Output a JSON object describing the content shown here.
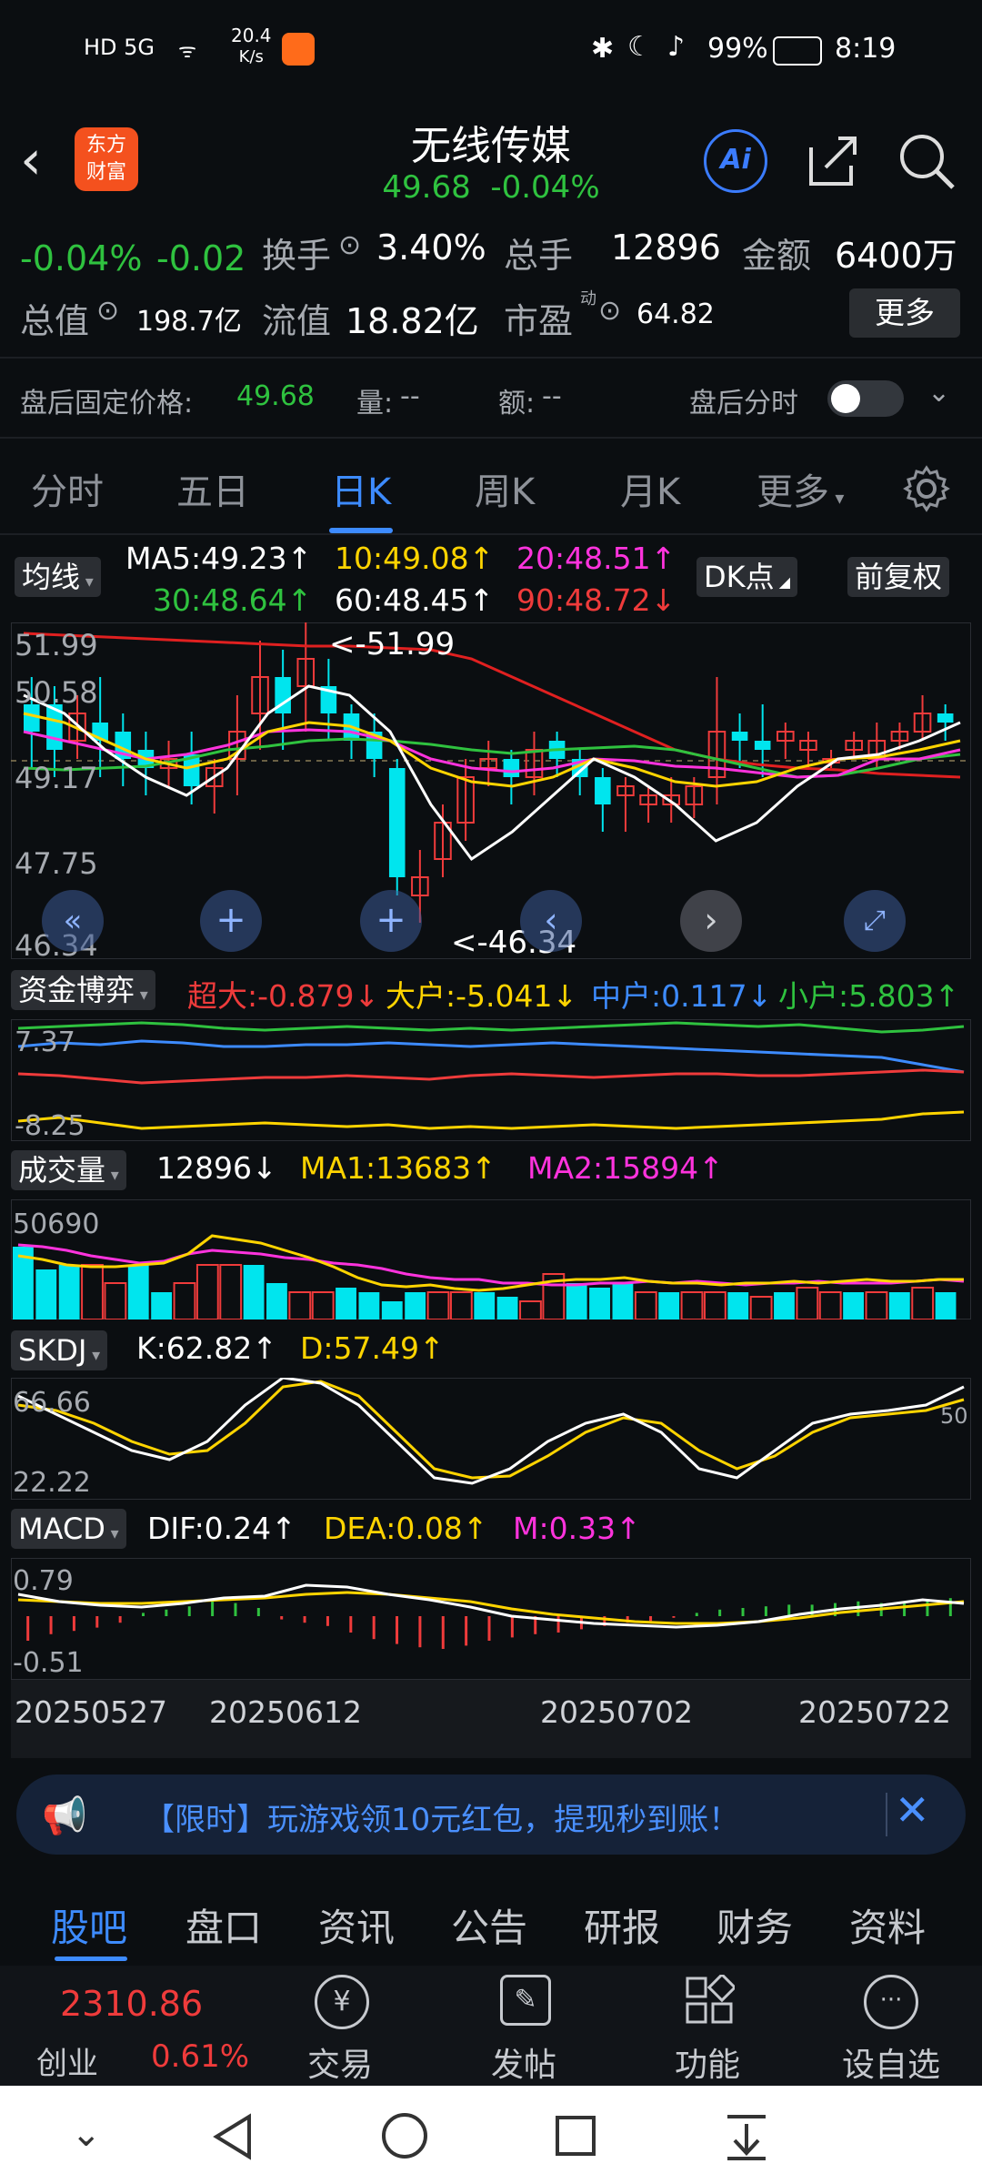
{
  "status_bar": {
    "left": "HD 5G",
    "speed": "20.4",
    "speed_unit": "K/s",
    "battery": "99%",
    "time": "8:19"
  },
  "header": {
    "logo_text_1": "东方",
    "logo_text_2": "财富",
    "stock_name": "无线传媒",
    "price": "49.68",
    "change_pct": "-0.04%",
    "ai_label": "Ai"
  },
  "stats": {
    "pct": "-0.04%",
    "change": "-0.02",
    "turnover_label": "换手",
    "turnover_value": "3.40%",
    "volume_label": "总手",
    "volume_value": "12896",
    "amount_label": "金额",
    "amount_value": "6400万",
    "mktcap_label": "总值",
    "mktcap_value": "198.7亿",
    "float_label": "流值",
    "float_value": "18.82亿",
    "pe_label": "市盈",
    "pe_sup": "动",
    "pe_value": "64.82",
    "more": "更多"
  },
  "afterhours": {
    "price_label": "盘后固定价格:",
    "price_value": "49.68",
    "vol_label": "量:",
    "vol_value": "--",
    "amt_label": "额:",
    "amt_value": "--",
    "toggle_label": "盘后分时"
  },
  "tabs": [
    "分时",
    "五日",
    "日K",
    "周K",
    "月K",
    "更多"
  ],
  "active_tab": "日K",
  "ma_panel": {
    "label": "均线",
    "ma5": "MA5:49.23",
    "ma10": "10:49.08",
    "ma20": "20:48.51",
    "ma30": "30:48.64",
    "ma60": "60:48.45",
    "ma90": "90:48.72",
    "dk_btn": "DK点",
    "adj_btn": "前复权",
    "axis": [
      "51.99",
      "50.58",
      "49.17",
      "47.75",
      "46.34"
    ],
    "high_mark": "<-51.99",
    "low_mark": "<-46.34"
  },
  "fund_panel": {
    "label": "资金博弈",
    "super": "超大:-0.879",
    "big": "大户:-5.041",
    "mid": "中户:0.117",
    "small": "小户:5.803",
    "axis_top": "7.37",
    "axis_bottom": "-8.25"
  },
  "volume_panel": {
    "label": "成交量",
    "value": "12896",
    "ma1": "MA1:13683",
    "ma2": "MA2:15894",
    "axis_top": "50690"
  },
  "skdj_panel": {
    "label": "SKDJ",
    "k": "K:62.82",
    "d": "D:57.49",
    "axis_top": "66.66",
    "axis_bottom": "22.22",
    "right_mark": "50"
  },
  "macd_panel": {
    "label": "MACD",
    "dif": "DIF:0.24",
    "dea": "DEA:0.08",
    "m": "M:0.33",
    "axis_top": "0.79",
    "axis_bottom": "-0.51"
  },
  "dates": [
    "20250527",
    "20250612",
    "20250702",
    "20250722"
  ],
  "ad": {
    "text": "【限时】玩游戏领10元红包，提现秒到账！"
  },
  "bottom_tabs": [
    "股吧",
    "盘口",
    "资讯",
    "公告",
    "研报",
    "财务",
    "资料"
  ],
  "bottom_bar": {
    "index_value": "2310.86",
    "index_name": "创业",
    "index_change": "0.61%",
    "trade": "交易",
    "post": "发帖",
    "func": "功能",
    "watch": "设自选"
  },
  "colors": {
    "up": "#ef3b3b",
    "down": "#00e5ee",
    "down_text": "#2fc23f",
    "accent": "#3d8bff",
    "ma5": "#ffffff",
    "ma10": "#ffd400",
    "ma20": "#ff33dd",
    "ma30": "#2fc23f",
    "ma90": "#e02020"
  }
}
